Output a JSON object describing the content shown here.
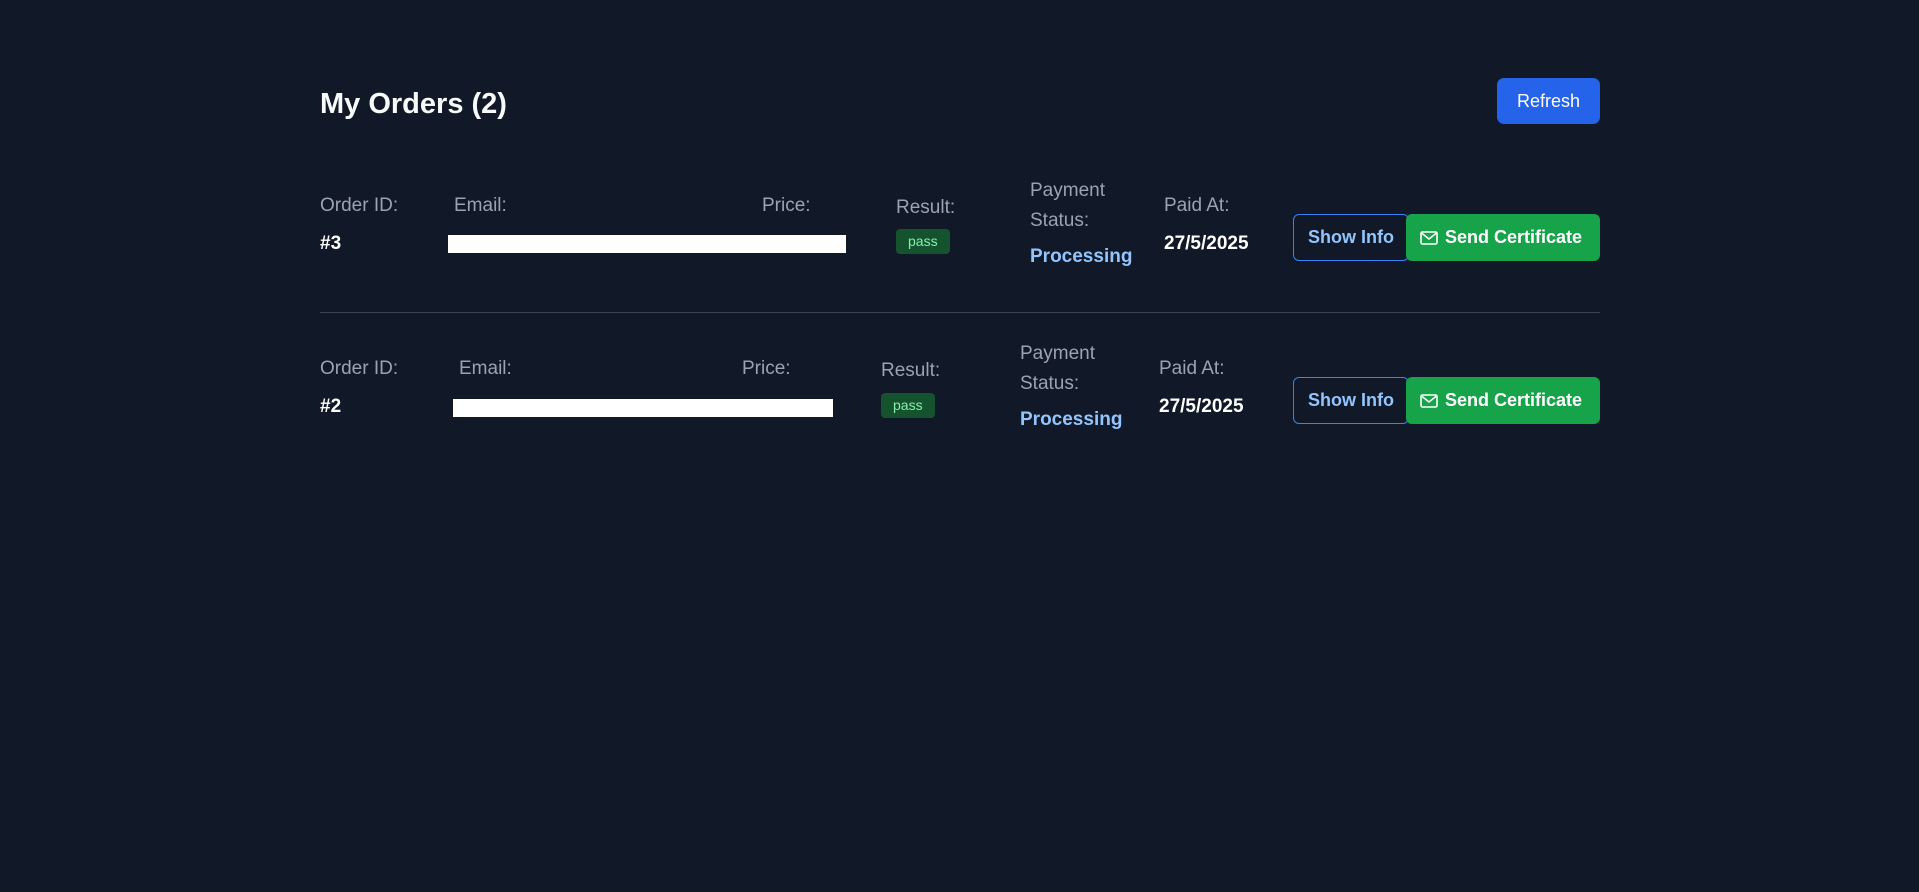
{
  "header": {
    "title": "My Orders (2)",
    "refresh_label": "Refresh"
  },
  "labels": {
    "order_id": "Order ID:",
    "email": "Email:",
    "price": "Price:",
    "result": "Result:",
    "payment_status_line1": "Payment",
    "payment_status_line2": "Status:",
    "paid_at": "Paid At:"
  },
  "orders": [
    {
      "id": "#3",
      "email": "",
      "price": "",
      "result": "pass",
      "payment_status": "Processing",
      "paid_at": "27/5/2025",
      "show_info_label": "Show Info",
      "send_certificate_label": "Send Certificate"
    },
    {
      "id": "#2",
      "email": "",
      "price": "",
      "result": "pass",
      "payment_status": "Processing",
      "paid_at": "27/5/2025",
      "show_info_label": "Show Info",
      "send_certificate_label": "Send Certificate"
    }
  ],
  "icons": {
    "send_certificate": "mail-icon"
  },
  "colors": {
    "background": "#111827",
    "primary": "#2563eb",
    "success": "#16a34a",
    "status_text": "#93c5fd",
    "badge_bg": "#14532d",
    "badge_text": "#86efac"
  }
}
